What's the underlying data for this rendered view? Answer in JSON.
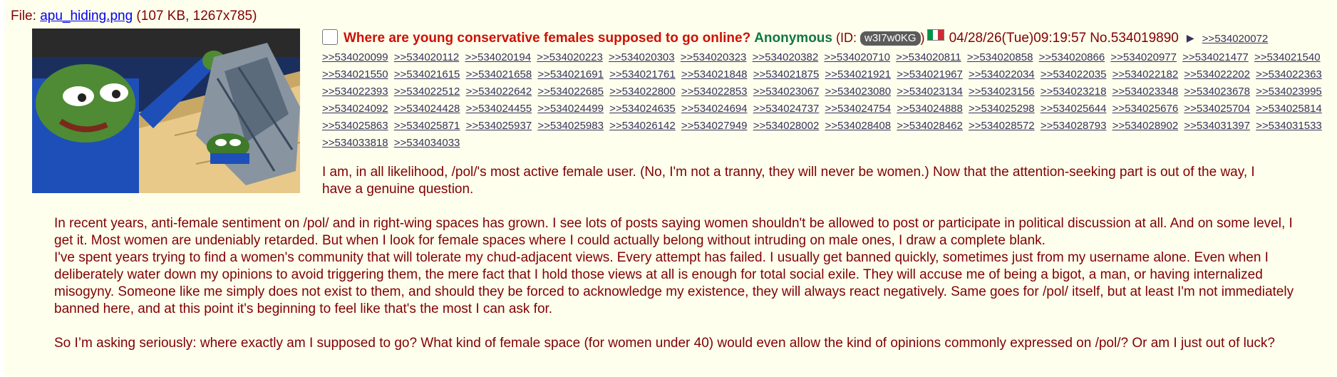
{
  "file": {
    "prefix": "File: ",
    "filename": "apu_hiding.png",
    "meta": " (107 KB, 1267x785)"
  },
  "post": {
    "subject": "Where are young conservative females supposed to go online?",
    "name": "Anonymous",
    "id_open": "(ID: ",
    "poster_id": "w3I7w0KG",
    "id_close": ")",
    "flag_colors": [
      "#009246",
      "#ffffff",
      "#ce2b37"
    ],
    "datetime": "04/28/26(Tue)09:19:57",
    "number": "No.534019890",
    "first_backlink": ">>534020072",
    "backlinks": [
      ">>534020099",
      ">>534020112",
      ">>534020194",
      ">>534020223",
      ">>534020303",
      ">>534020323",
      ">>534020382",
      ">>534020710",
      ">>534020811",
      ">>534020858",
      ">>534020866",
      ">>534020977",
      ">>534021477",
      ">>534021540",
      ">>534021550",
      ">>534021615",
      ">>534021658",
      ">>534021691",
      ">>534021761",
      ">>534021848",
      ">>534021875",
      ">>534021921",
      ">>534021967",
      ">>534022034",
      ">>534022035",
      ">>534022182",
      ">>534022202",
      ">>534022363",
      ">>534022393",
      ">>534022512",
      ">>534022642",
      ">>534022685",
      ">>534022800",
      ">>534022853",
      ">>534023067",
      ">>534023080",
      ">>534023134",
      ">>534023156",
      ">>534023218",
      ">>534023348",
      ">>534023678",
      ">>534023995",
      ">>534024092",
      ">>534024428",
      ">>534024455",
      ">>534024499",
      ">>534024635",
      ">>534024694",
      ">>534024737",
      ">>534024754",
      ">>534024888",
      ">>534025298",
      ">>534025644",
      ">>534025676",
      ">>534025704",
      ">>534025814",
      ">>534025863",
      ">>534025871",
      ">>534025937",
      ">>534025983",
      ">>534026142",
      ">>534027949",
      ">>534028002",
      ">>534028408",
      ">>534028462",
      ">>534028572",
      ">>534028793",
      ">>534028902",
      ">>534031397",
      ">>534031533",
      ">>534033818",
      ">>534034033"
    ],
    "paragraphs": [
      "I am, in all likelihood, /pol/'s most active female user. (No, I'm not a tranny, they will never be women.) Now that the attention-seeking part is out of the way, I have a genuine question.",
      "In recent years, anti-female sentiment on /pol/ and in right-wing spaces has grown. I see lots of posts saying women shouldn't be allowed to post or participate in political discussion at all. And on some level, I get it. Most women are undeniably retarded. But when I look for female spaces where I could actually belong without intruding on male ones, I draw a complete blank.\nI've spent years trying to find a women's community that will tolerate my chud-adjacent views. Every attempt has failed. I usually get banned quickly, sometimes just from my username alone. Even when I deliberately water down my opinions to avoid triggering them, the mere fact that I hold those views at all is enough for total social exile. They will accuse me of being a bigot, a man, or having internalized misogyny. Someone like me simply does not exist to them, and should they be forced to acknowledge my existence, they will always react negatively. Same goes for /pol/ itself, but at least I'm not immediately banned here, and at this point it's beginning to feel like that's the most I can ask for.",
      "So I’m asking seriously: where exactly am I supposed to go? What kind of female space (for women under 40) would even allow the kind of opinions commonly expressed on /pol/? Or am I just out of luck?"
    ]
  },
  "icons": {
    "select": "checkbox-icon",
    "flag": "italy-flag-icon",
    "menu": "play-arrow-icon"
  },
  "colors": {
    "background": "#ffffee",
    "text": "#800000",
    "subject": "#cc1105",
    "name": "#117743",
    "link": "#34345c"
  }
}
